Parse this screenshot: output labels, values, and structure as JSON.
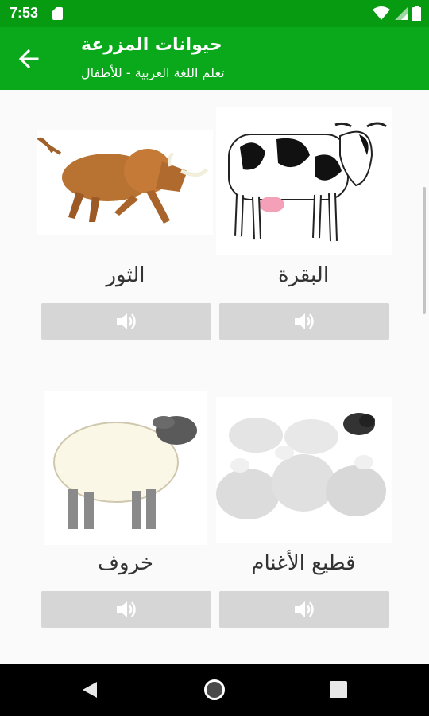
{
  "status_bar": {
    "time": "7:53"
  },
  "app_bar": {
    "title": "حيوانات المزرعة",
    "subtitle": "تعلم اللغة العربية - للأطفال"
  },
  "animals": [
    {
      "name": "الثور",
      "image_icon": "bull-icon",
      "sound_icon": "speaker-icon"
    },
    {
      "name": "البقرة",
      "image_icon": "cow-icon",
      "sound_icon": "speaker-icon"
    },
    {
      "name": "خروف",
      "image_icon": "sheep-icon",
      "sound_icon": "speaker-icon"
    },
    {
      "name": "قطيع الأغنام",
      "image_icon": "flock-icon",
      "sound_icon": "speaker-icon"
    }
  ],
  "colors": {
    "status_bar": "#079b12",
    "app_bar": "#0aa91b",
    "button": "#d6d6d6",
    "nav_bar": "#000000"
  }
}
